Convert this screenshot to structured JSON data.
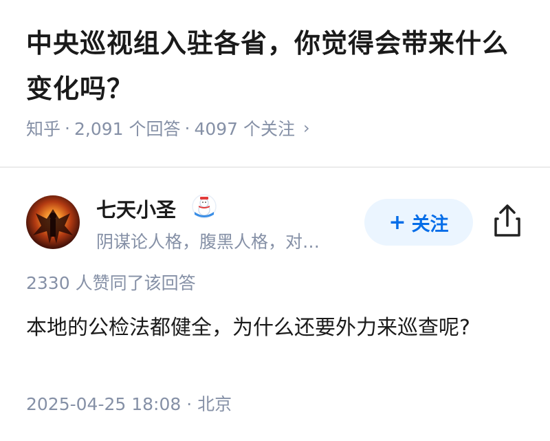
{
  "question": {
    "title": "中央巡视组入驻各省，你觉得会带来什么变化吗？",
    "source": "知乎",
    "answer_count": "2,091 个回答",
    "follower_count": "4097 个关注",
    "separator": "·",
    "chevron": "›"
  },
  "author": {
    "name": "七天小圣",
    "bio": "阴谋论人格，腹黑人格，对…",
    "avatar_icon": "avatar-image",
    "badge_icon": "snowman-badge-icon"
  },
  "actions": {
    "follow_plus": "+",
    "follow_label": "关注",
    "share_icon": "share-icon"
  },
  "answer": {
    "upvotes": "2330 人赞同了该回答",
    "content": "本地的公检法都健全，为什么还要外力来巡查呢?",
    "timestamp": "2025-04-25 18:08",
    "location": "北京",
    "meta_separator": "·"
  },
  "colors": {
    "accent": "#056de8",
    "accent_bg": "#ebf5ff",
    "muted": "#8590a6",
    "text": "#1a1a1a"
  }
}
